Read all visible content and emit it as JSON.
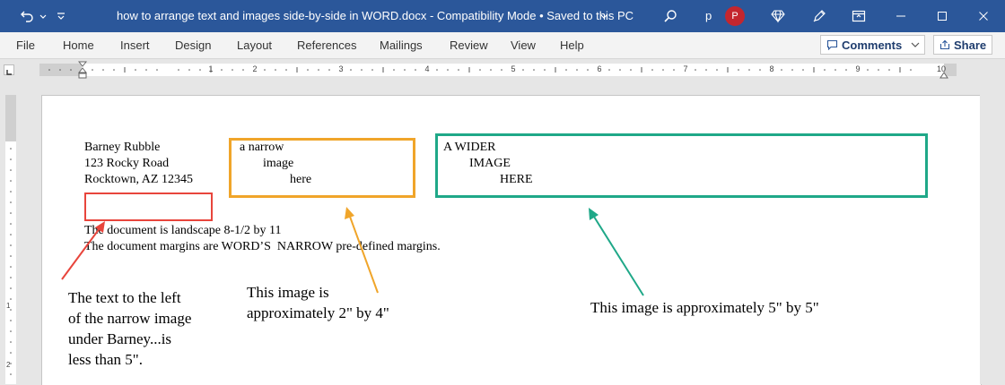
{
  "titlebar": {
    "doc_title": "how to arrange text and images side-by-side in WORD.docx  -  Compatibility Mode • Saved to this PC",
    "user_initial": "p",
    "avatar_letter": "P",
    "background": "#2b579a"
  },
  "ribbon": {
    "tabs": [
      "File",
      "Home",
      "Insert",
      "Design",
      "Layout",
      "References",
      "Mailings",
      "Review",
      "View",
      "Help"
    ],
    "comments_label": "Comments",
    "share_label": "Share"
  },
  "ruler": {
    "numbers": [
      "1",
      "2",
      "3",
      "4",
      "5",
      "6",
      "7",
      "8",
      "9",
      "10"
    ]
  },
  "vruler": {
    "numbers": [
      "1",
      "2"
    ]
  },
  "document": {
    "address_line1": "Barney Rubble",
    "address_line2": "123 Rocky Road",
    "address_line3": "Rocktown, AZ 12345",
    "narrow_line1": "a narrow",
    "narrow_line2": "image",
    "narrow_line3": "here",
    "wide_line1": "A WIDER",
    "wide_line2": "IMAGE",
    "wide_line3": "HERE",
    "info_line1": "The document is landscape 8-1/2 by 11",
    "info_line2": "The document margins are WORD’S  NARROW pre-defined margins."
  },
  "annotations": {
    "red_note_1": "The text to the left",
    "red_note_2": "of the narrow image",
    "red_note_3": "under Barney...is",
    "red_note_4": "less than 5\".",
    "orange_note_1": "This image is",
    "orange_note_2": "approximately 2\" by 4\"",
    "green_note": "This image is approximately 5\" by 5\"",
    "colors": {
      "red": "#e8453c",
      "orange": "#f0a52a",
      "green": "#1fa888"
    }
  }
}
